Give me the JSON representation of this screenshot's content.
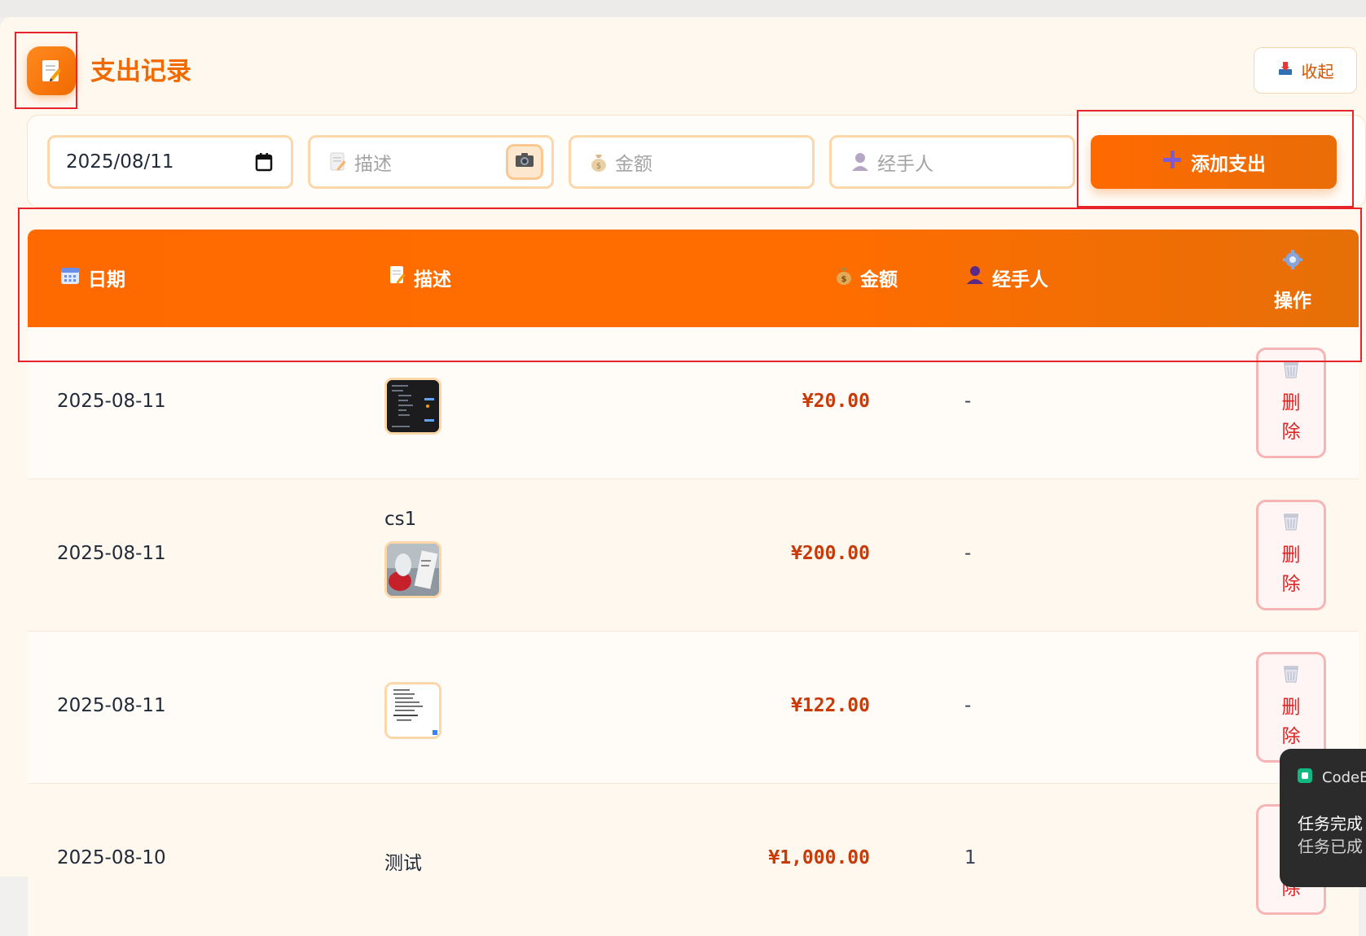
{
  "header": {
    "title": "支出记录",
    "collapse_label": "收起"
  },
  "form": {
    "date_value": "2025/08/11",
    "desc_placeholder": "描述",
    "amount_placeholder": "金额",
    "handler_placeholder": "经手人",
    "add_button_label": "添加支出"
  },
  "table": {
    "headers": {
      "date": "日期",
      "desc": "描述",
      "amount": "金额",
      "handler": "经手人",
      "op": "操作"
    },
    "delete_label": "删除",
    "rows": [
      {
        "date": "2025-08-11",
        "desc": "",
        "amount": "¥20.00",
        "handler": "-",
        "thumbnail": "dark-screenshot"
      },
      {
        "date": "2025-08-11",
        "desc": "cs1",
        "amount": "¥200.00",
        "handler": "-",
        "thumbnail": "photo"
      },
      {
        "date": "2025-08-11",
        "desc": "",
        "amount": "¥122.00",
        "handler": "-",
        "thumbnail": "document"
      },
      {
        "date": "2025-08-10",
        "desc": "测试",
        "amount": "¥1,000.00",
        "handler": "1",
        "thumbnail": ""
      }
    ]
  },
  "toast": {
    "app_name": "CodeB",
    "line1": "任务完成",
    "line2": "任务已成"
  },
  "colors": {
    "accent": "#f06a00",
    "amount": "#c83a08",
    "delete": "#dc2626",
    "annotation": "#e8242b"
  },
  "icons": {
    "header": "memo-icon",
    "collapse": "inbox-tray-icon",
    "camera": "camera-icon",
    "money": "money-bag-icon",
    "user": "user-icon",
    "add": "plus-icon",
    "calendar": "calendar-icon",
    "settings": "gear-icon",
    "delete": "wastebasket-icon"
  }
}
